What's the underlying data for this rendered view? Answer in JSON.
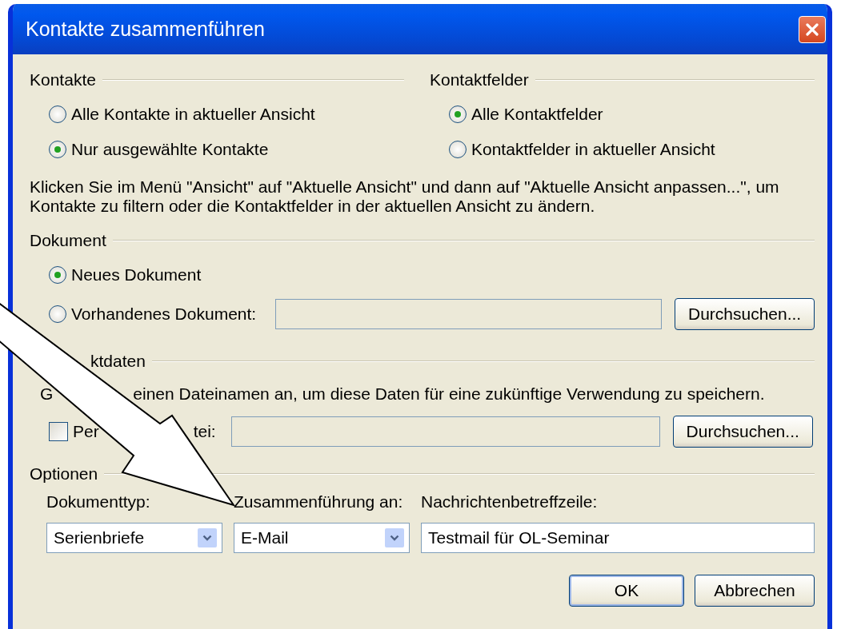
{
  "window": {
    "title": "Kontakte zusammenführen"
  },
  "contacts_group": {
    "heading": "Kontakte",
    "options": [
      {
        "label": "Alle Kontakte in aktueller Ansicht",
        "selected": false
      },
      {
        "label": "Nur ausgewählte Kontakte",
        "selected": true
      }
    ]
  },
  "fields_group": {
    "heading": "Kontaktfelder",
    "options": [
      {
        "label": "Alle Kontaktfelder",
        "selected": true
      },
      {
        "label": "Kontaktfelder in aktueller Ansicht",
        "selected": false
      }
    ]
  },
  "hint": "Klicken Sie im Menü \"Ansicht\" auf \"Aktuelle Ansicht\" und dann auf \"Aktuelle Ansicht anpassen...\", um Kontakte zu filtern oder die Kontaktfelder in der aktuellen Ansicht zu ändern.",
  "document_group": {
    "heading": "Dokument",
    "options": [
      {
        "label": "Neues Dokument",
        "selected": true
      },
      {
        "label": "Vorhandenes Dokument:",
        "selected": false
      }
    ],
    "browse_button": "Durchsuchen..."
  },
  "contact_data_group": {
    "heading_fragment": "ktdaten",
    "hint_fragments": [
      "G",
      "einen Dateinamen an, um diese Daten für eine zukünftige Verwendung zu speichern."
    ],
    "checkbox": {
      "label_fragments": [
        "Per",
        "tei:"
      ],
      "checked": false
    },
    "browse_button": "Durchsuchen..."
  },
  "options_group": {
    "heading": "Optionen",
    "document_type": {
      "label": "Dokumenttyp:",
      "value": "Serienbriefe"
    },
    "merge_to": {
      "label": "Zusammenführung an:",
      "value": "E-Mail"
    },
    "subject": {
      "label": "Nachrichtenbetreffzeile:",
      "value": "Testmail für OL-Seminar"
    }
  },
  "buttons": [
    "OK",
    "Abbrechen"
  ]
}
